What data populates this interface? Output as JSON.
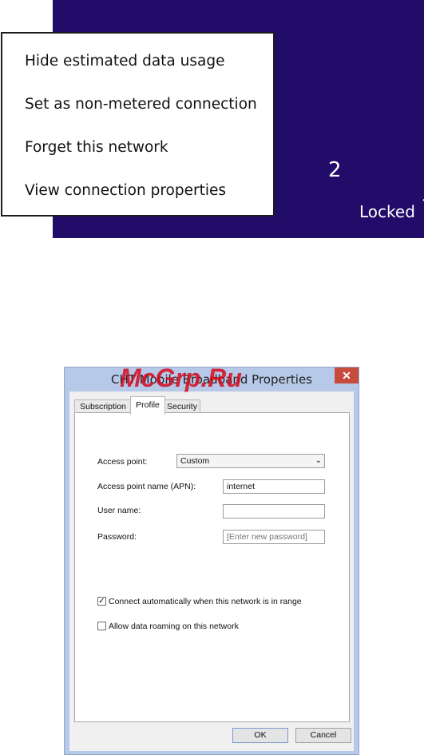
{
  "tile": {
    "network_suffix": "2",
    "status": "Locked",
    "signal_icon": "signal-strength-icon"
  },
  "context_menu": {
    "items": [
      "Hide estimated data usage",
      "Set as non-metered connection",
      "Forget this network",
      "View connection properties"
    ]
  },
  "dialog": {
    "title": "CHT Mobile Broadband Properties",
    "close_label": "✕",
    "tabs": [
      {
        "label": "Subscription",
        "active": false
      },
      {
        "label": "Profile",
        "active": true
      },
      {
        "label": "Security",
        "active": false
      }
    ],
    "access_point": {
      "label": "Access point:",
      "value": "Custom"
    },
    "apn": {
      "label": "Access point name (APN):",
      "value": "internet"
    },
    "username": {
      "label": "User name:",
      "value": ""
    },
    "password": {
      "label": "Password:",
      "placeholder": "[Enter new password]"
    },
    "connect_auto": {
      "label": "Connect automatically when this network is in range",
      "checked": true
    },
    "roaming": {
      "label": "Allow data roaming on this network",
      "checked": false
    },
    "ok_label": "OK",
    "cancel_label": "Cancel"
  },
  "watermark": "McGrp.Ru",
  "colors": {
    "tile_bg": "#220c6a",
    "dialog_frame": "#b7c9e8",
    "close_red": "#c74b3c",
    "watermark_red": "#d60a1e"
  }
}
